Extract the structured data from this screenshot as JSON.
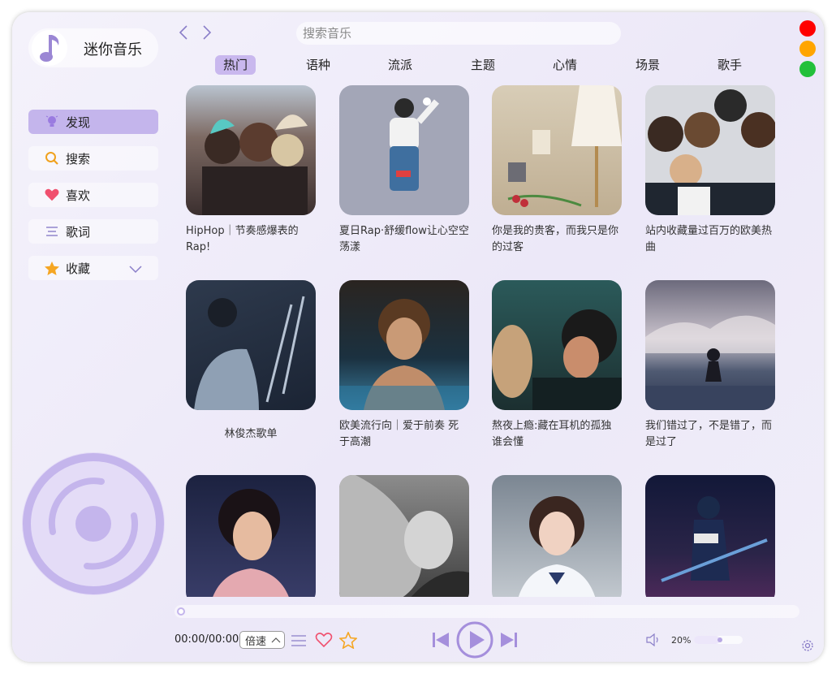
{
  "app": {
    "title": "迷你音乐",
    "accent": "#a58fdc",
    "accent_light": "#c4b5ec"
  },
  "sidebar": {
    "items": [
      {
        "label": "发现",
        "icon": "bulb-icon",
        "active": true
      },
      {
        "label": "搜索",
        "icon": "search-icon",
        "active": false
      },
      {
        "label": "喜欢",
        "icon": "heart-icon",
        "active": false
      },
      {
        "label": "歌词",
        "icon": "lyrics-icon",
        "active": false
      },
      {
        "label": "收藏",
        "icon": "star-icon",
        "active": false
      }
    ]
  },
  "search": {
    "placeholder": "搜索音乐"
  },
  "window_controls": {
    "close": "#ff0000",
    "minimize": "#ffa500",
    "maximize": "#22c03a"
  },
  "tabs": [
    {
      "label": "热门",
      "active": true
    },
    {
      "label": "语种",
      "active": false
    },
    {
      "label": "流派",
      "active": false
    },
    {
      "label": "主题",
      "active": false
    },
    {
      "label": "心情",
      "active": false
    },
    {
      "label": "场景",
      "active": false
    },
    {
      "label": "歌手",
      "active": false
    }
  ],
  "playlists": [
    {
      "title": "HipHop｜节奏感爆表的Rap!"
    },
    {
      "title": "夏日Rap·舒缓flow让心空空荡漾"
    },
    {
      "title": "你是我的贵客，而我只是你的过客"
    },
    {
      "title": "站内收藏量过百万的欧美热曲"
    },
    {
      "title": "林俊杰歌单"
    },
    {
      "title": "欧美流行向｜爱于前奏 死于高潮"
    },
    {
      "title": "熬夜上瘾:藏在耳机的孤独谁会懂"
    },
    {
      "title": "我们错过了，不是错了，而是过了"
    },
    {
      "title": ""
    },
    {
      "title": ""
    },
    {
      "title": ""
    },
    {
      "title": ""
    }
  ],
  "player": {
    "time": "00:00/00:00",
    "speed_label": "倍速",
    "volume_label": "20%",
    "volume": 0.2,
    "progress": 0
  }
}
